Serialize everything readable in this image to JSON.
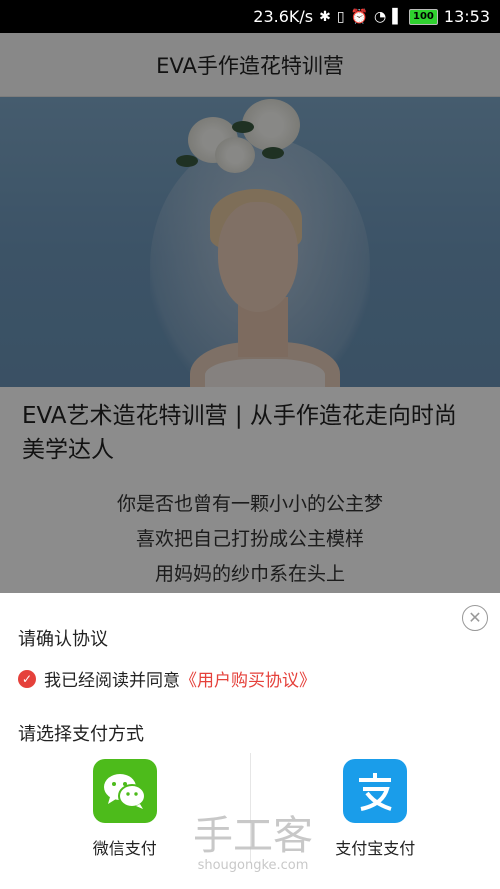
{
  "status_bar": {
    "speed": "23.6K/s",
    "battery": "100",
    "time": "13:53"
  },
  "page": {
    "title": "EVA手作造花特训营",
    "article_title": "EVA艺术造花特训营 | 从手作造花走向时尚美学达人",
    "article_lines": [
      "你是否也曾有一颗小小的公主梦",
      "喜欢把自己打扮成公主模样",
      "用妈妈的纱巾系在头上"
    ]
  },
  "sheet": {
    "confirm_label": "请确认协议",
    "agree_text": "我已经阅读并同意",
    "agree_link": "《用户购买协议》",
    "pay_method_label": "请选择支付方式",
    "options": [
      {
        "label": "微信支付",
        "icon": "wechat-icon"
      },
      {
        "label": "支付宝支付",
        "icon": "alipay-icon"
      }
    ]
  },
  "watermark": {
    "cn": "手工客",
    "en": "shougongke.com"
  },
  "colors": {
    "accent_red": "#e5413b",
    "wechat_green": "#4dbb1b",
    "alipay_blue": "#1a9dea"
  }
}
